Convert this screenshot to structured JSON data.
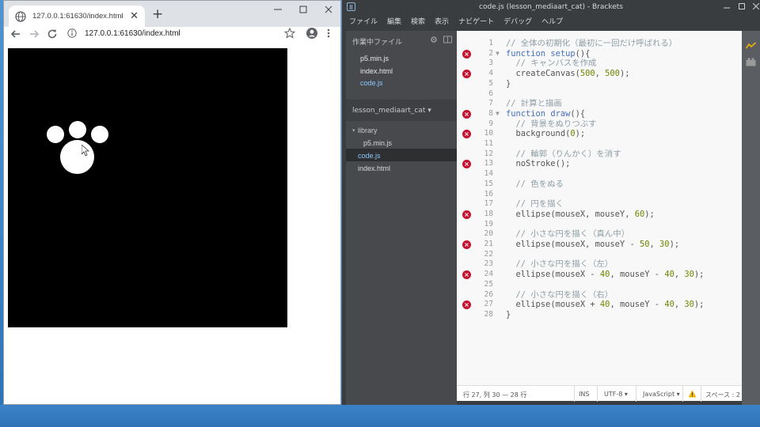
{
  "chrome": {
    "tab_title": "127.0.0.1:61630/index.html",
    "url": "127.0.0.1:61630/index.html",
    "new_tab_label": "+",
    "close_tab_label": "✕"
  },
  "canvas": {
    "background": "#000000",
    "paw_color": "#ffffff"
  },
  "brackets": {
    "window_title": "code.js (lesson_mediaart_cat) - Brackets",
    "menu": [
      "ファイル",
      "編集",
      "検索",
      "表示",
      "ナビゲート",
      "デバッグ",
      "ヘルプ"
    ],
    "sidebar": {
      "working_files_header": "作業中ファイル",
      "working_files": [
        "p5.min.js",
        "index.html",
        "code.js"
      ],
      "project_name": "lesson_mediaart_cat ▾",
      "tree": {
        "folder": "library",
        "folder_child": "p5.min.js",
        "files": [
          "code.js",
          "index.html"
        ]
      }
    },
    "code_lines": [
      {
        "n": "1",
        "err": false,
        "text": "// 全体の初期化（最初に一回だけ呼ばれる）"
      },
      {
        "n": "2",
        "err": true,
        "text": "function setup(){"
      },
      {
        "n": "3",
        "err": false,
        "text": "  // キャンバスを作成"
      },
      {
        "n": "4",
        "err": true,
        "text": "  createCanvas(500, 500);"
      },
      {
        "n": "5",
        "err": false,
        "text": "}"
      },
      {
        "n": "6",
        "err": false,
        "text": ""
      },
      {
        "n": "7",
        "err": false,
        "text": "// 計算と描画"
      },
      {
        "n": "8",
        "err": true,
        "text": "function draw(){"
      },
      {
        "n": "9",
        "err": false,
        "text": "  // 背景をぬりつぶす"
      },
      {
        "n": "10",
        "err": true,
        "text": "  background(0);"
      },
      {
        "n": "11",
        "err": false,
        "text": ""
      },
      {
        "n": "12",
        "err": false,
        "text": "  // 輪郭（りんかく）を消す"
      },
      {
        "n": "13",
        "err": true,
        "text": "  noStroke();"
      },
      {
        "n": "14",
        "err": false,
        "text": ""
      },
      {
        "n": "15",
        "err": false,
        "text": "  // 色をぬる"
      },
      {
        "n": "16",
        "err": false,
        "text": ""
      },
      {
        "n": "17",
        "err": false,
        "text": "  // 円を描く"
      },
      {
        "n": "18",
        "err": true,
        "text": "  ellipse(mouseX, mouseY, 60);"
      },
      {
        "n": "19",
        "err": false,
        "text": ""
      },
      {
        "n": "20",
        "err": false,
        "text": "  // 小さな円を描く（真ん中）"
      },
      {
        "n": "21",
        "err": true,
        "text": "  ellipse(mouseX, mouseY - 50, 30);"
      },
      {
        "n": "22",
        "err": false,
        "text": ""
      },
      {
        "n": "23",
        "err": false,
        "text": "  // 小さな円を描く（左）"
      },
      {
        "n": "24",
        "err": true,
        "text": "  ellipse(mouseX - 40, mouseY - 40, 30);"
      },
      {
        "n": "25",
        "err": false,
        "text": ""
      },
      {
        "n": "26",
        "err": false,
        "text": "  // 小さな円を描く（右）"
      },
      {
        "n": "27",
        "err": true,
        "text": "  ellipse(mouseX + 40, mouseY - 40, 30);"
      },
      {
        "n": "28",
        "err": false,
        "text": "}"
      }
    ],
    "status": {
      "position": "行 27, 列 30 — 28 行",
      "ins": "INS",
      "encoding": "UTF-8 ▾",
      "language": "JavaScript ▾",
      "spaces": "スペース : 2"
    }
  },
  "colors": {
    "error": "#c4122f",
    "comment": "#8e9ea5",
    "keyword": "#446fbd",
    "number": "#6d8600",
    "active_file": "#8fc8ff"
  }
}
